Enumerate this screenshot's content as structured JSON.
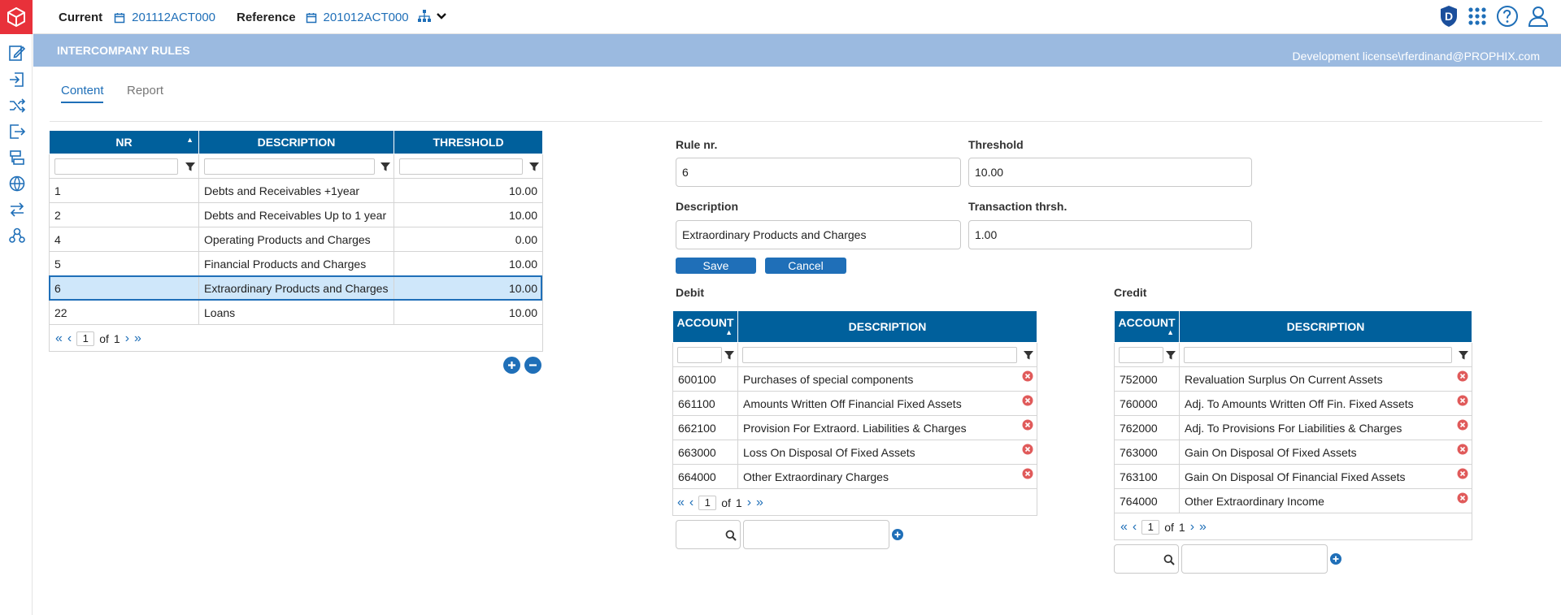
{
  "topbar": {
    "current_label": "Current",
    "current_value": "201112ACT000",
    "reference_label": "Reference",
    "reference_value": "201012ACT000",
    "user_badge": "D"
  },
  "title_band": {
    "title": "INTERCOMPANY RULES",
    "license": "Development license\\rferdinand@PROPHIX.com"
  },
  "tabs": [
    {
      "label": "Content",
      "active": true
    },
    {
      "label": "Report",
      "active": false
    }
  ],
  "rules_grid": {
    "columns": [
      "NR",
      "DESCRIPTION",
      "THRESHOLD"
    ],
    "rows": [
      {
        "nr": "1",
        "description": "Debts and Receivables +1year",
        "threshold": "10.00"
      },
      {
        "nr": "2",
        "description": "Debts and Receivables Up to 1 year",
        "threshold": "10.00"
      },
      {
        "nr": "4",
        "description": "Operating Products and Charges",
        "threshold": "0.00"
      },
      {
        "nr": "5",
        "description": "Financial Products and Charges",
        "threshold": "10.00"
      },
      {
        "nr": "6",
        "description": "Extraordinary Products and Charges",
        "threshold": "10.00"
      },
      {
        "nr": "22",
        "description": "Loans",
        "threshold": "10.00"
      }
    ],
    "selected_row": "6",
    "pager": {
      "page": "1",
      "of_text": "of",
      "total": "1"
    }
  },
  "form": {
    "rule_nr_label": "Rule nr.",
    "rule_nr_value": "6",
    "threshold_label": "Threshold",
    "threshold_value": "10.00",
    "description_label": "Description",
    "description_value": "Extraordinary Products and Charges",
    "transaction_label": "Transaction thrsh.",
    "transaction_value": "1.00",
    "save_label": "Save",
    "cancel_label": "Cancel"
  },
  "debit": {
    "title": "Debit",
    "columns": [
      "ACCOUNT",
      "DESCRIPTION"
    ],
    "rows": [
      {
        "account": "600100",
        "description": "Purchases of special components"
      },
      {
        "account": "661100",
        "description": "Amounts Written Off Financial Fixed Assets"
      },
      {
        "account": "662100",
        "description": "Provision For Extraord. Liabilities & Charges"
      },
      {
        "account": "663000",
        "description": "Loss On Disposal Of Fixed Assets"
      },
      {
        "account": "664000",
        "description": "Other Extraordinary Charges"
      }
    ],
    "pager": {
      "page": "1",
      "of_text": "of",
      "total": "1"
    }
  },
  "credit": {
    "title": "Credit",
    "columns": [
      "ACCOUNT",
      "DESCRIPTION"
    ],
    "rows": [
      {
        "account": "752000",
        "description": "Revaluation Surplus On Current Assets"
      },
      {
        "account": "760000",
        "description": "Adj. To Amounts Written Off Fin. Fixed Assets"
      },
      {
        "account": "762000",
        "description": "Adj. To Provisions For Liabilities & Charges"
      },
      {
        "account": "763000",
        "description": "Gain On Disposal Of Fixed Assets"
      },
      {
        "account": "763100",
        "description": "Gain On Disposal Of Financial Fixed Assets"
      },
      {
        "account": "764000",
        "description": "Other Extraordinary Income"
      }
    ],
    "pager": {
      "page": "1",
      "of_text": "of",
      "total": "1"
    }
  },
  "colors": {
    "brand_red": "#e8313a",
    "grid_header": "#00609c",
    "title_band": "#9bbae0",
    "accent": "#1f6fb8",
    "selected_row": "#cfe7fa"
  }
}
